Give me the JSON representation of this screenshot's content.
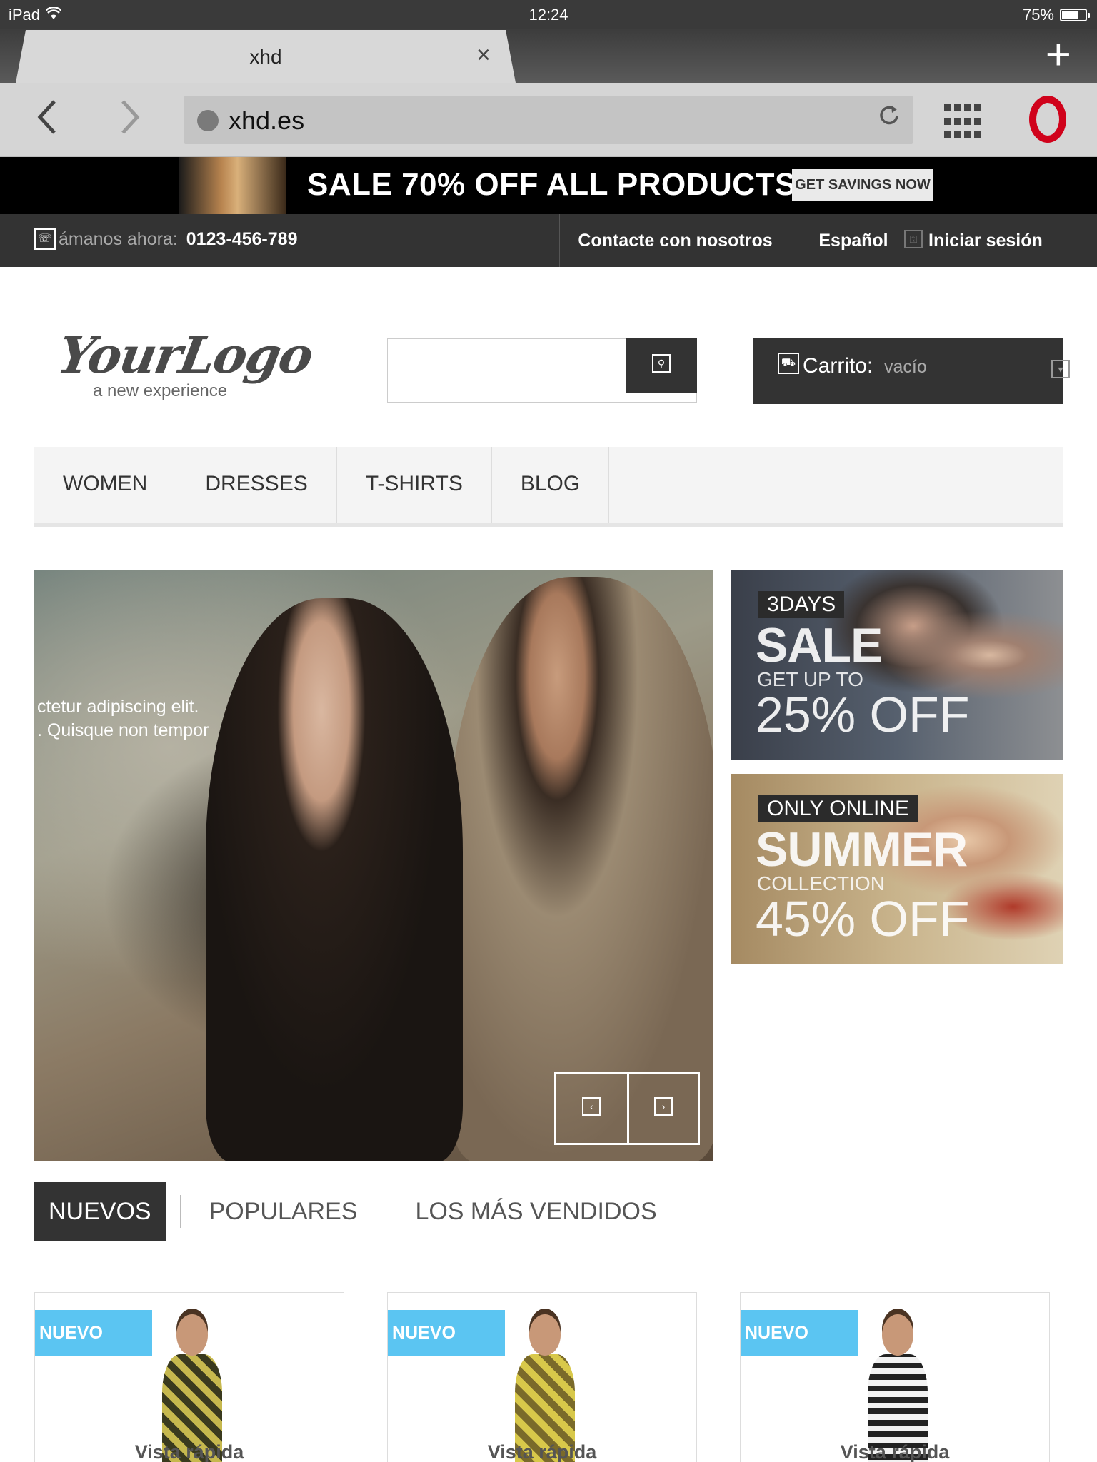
{
  "status_bar": {
    "device": "iPad",
    "time": "12:24",
    "battery": "75%",
    "battery_level": 0.75
  },
  "browser": {
    "tab_title": "xhd",
    "url": "xhd.es",
    "icons": {
      "back": "chevron-left-icon",
      "forward": "chevron-right-icon",
      "reload": "reload-icon",
      "speed_dial": "grid-icon",
      "menu": "opera-icon",
      "new_tab": "plus-icon",
      "close_tab": "close-icon"
    }
  },
  "sale_banner": {
    "text": "SALE 70% OFF ALL PRODUCTS",
    "button": "GET SAVINGS NOW"
  },
  "info_bar": {
    "call_label": "ámanos ahora:",
    "phone": "0123-456-789",
    "contact": "Contacte con nosotros",
    "language": "Español",
    "login": "Iniciar sesión"
  },
  "header": {
    "logo_main": "YourLogo",
    "logo_tagline": "a new experience",
    "cart_label": "Carrito:",
    "cart_value": "vacío"
  },
  "main_nav": {
    "items": [
      "WOMEN",
      "DRESSES",
      "T-SHIRTS",
      "BLOG"
    ]
  },
  "hero": {
    "caption_line1": "ctetur adipiscing elit.",
    "caption_line2": ". Quisque non tempor"
  },
  "promos": [
    {
      "tag": "3DAYS",
      "big": "SALE",
      "mid": "GET UP TO",
      "pct": "25% OFF"
    },
    {
      "tag": "ONLY ONLINE",
      "big": "SUMMER",
      "mid": "COLLECTION",
      "pct": "45% OFF"
    }
  ],
  "product_tabs": {
    "items": [
      "NUEVOS",
      "POPULARES",
      "LOS MÁS VENDIDOS"
    ],
    "active": "NUEVOS"
  },
  "products": [
    {
      "badge": "NUEVO",
      "quick_view": "Vista rápida"
    },
    {
      "badge": "NUEVO",
      "quick_view": "Vista rápida"
    },
    {
      "badge": "NUEVO",
      "quick_view": "Vista rápida"
    }
  ],
  "colors": {
    "dark_bar": "#333333",
    "badge_blue": "#5bc5f2",
    "opera_red": "#d0021b"
  }
}
